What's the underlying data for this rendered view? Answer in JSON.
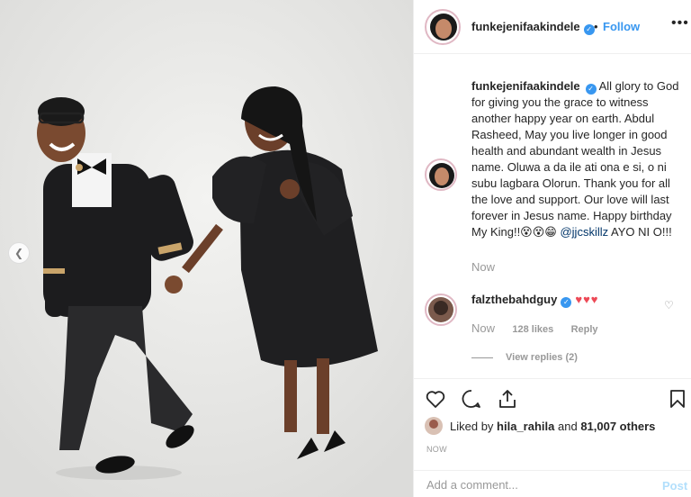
{
  "post": {
    "username": "funkejenifaakindele",
    "follow_label": "Follow",
    "separator": "•",
    "more_label": "•••",
    "carousel_prev": "❮",
    "caption_text": "All glory to God for giving you the grace to witness another happy year on earth. Abdul Rasheed, May you live longer in good health and abundant wealth in Jesus name. Oluwa a da ile ati ona e si, o ni subu lagbara Olorun. Thank you for all the love and support. Our love will last forever in Jesus name. Happy birthday My King!!😵😵😁",
    "caption_mention": "@jjcskillz",
    "caption_tail": "AYO NI O!!!",
    "caption_time": "Now"
  },
  "comment": {
    "username": "falzthebahdguy",
    "text": "♥♥♥",
    "time": "Now",
    "likes": "128 likes",
    "reply_label": "Reply",
    "view_replies": "View replies (2)"
  },
  "likes": {
    "prefix": "Liked by",
    "user": "hila_rahila",
    "conjunction": "and",
    "others": "81,007 others"
  },
  "timestamp": "NOW",
  "composer": {
    "placeholder": "Add a comment...",
    "post_label": "Post"
  },
  "colors": {
    "accent": "#3897f0",
    "heart": "#ed4956",
    "muted": "#999999",
    "post_disabled": "#b2dffc"
  }
}
